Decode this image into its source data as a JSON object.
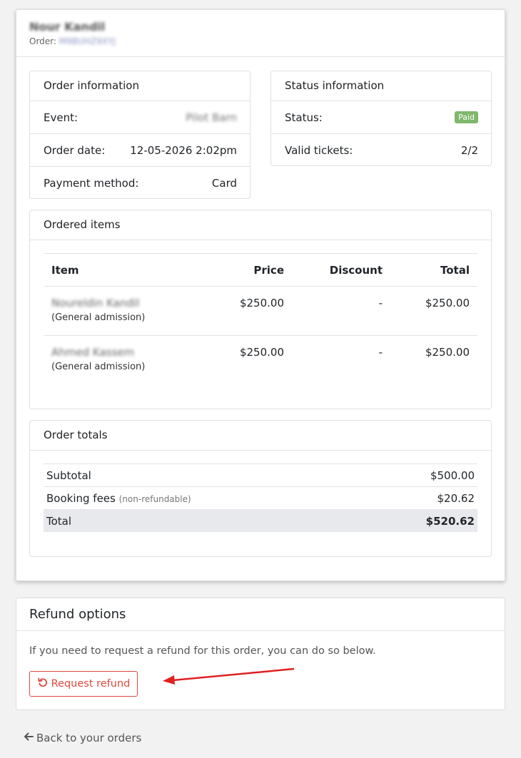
{
  "order": {
    "customer_name": "Nour Kandil",
    "order_label": "Order:",
    "order_number": "M9BUHZ9XYJ"
  },
  "order_information": {
    "title": "Order information",
    "rows": [
      {
        "label": "Event:",
        "value": "Pilot Barn"
      },
      {
        "label": "Order date:",
        "value": "12-05-2026 2:02pm"
      },
      {
        "label": "Payment method:",
        "value": "Card"
      }
    ]
  },
  "status_information": {
    "title": "Status information",
    "rows": [
      {
        "label": "Status:",
        "value": "Paid"
      },
      {
        "label": "Valid tickets:",
        "value": "2/2"
      }
    ]
  },
  "ordered_items": {
    "title": "Ordered items",
    "columns": [
      "Item",
      "Price",
      "Discount",
      "Total"
    ],
    "rows": [
      {
        "name": "Noureldin Kandil",
        "type": "(General admission)",
        "price": "$250.00",
        "discount": "-",
        "total": "$250.00"
      },
      {
        "name": "Ahmed Kassem",
        "type": "(General admission)",
        "price": "$250.00",
        "discount": "-",
        "total": "$250.00"
      }
    ]
  },
  "order_totals": {
    "title": "Order totals",
    "subtotal_label": "Subtotal",
    "subtotal_value": "$500.00",
    "fees_label": "Booking fees",
    "fees_note": "(non-refundable)",
    "fees_value": "$20.62",
    "total_label": "Total",
    "total_value": "$520.62"
  },
  "refund": {
    "title": "Refund options",
    "description": "If you need to request a refund for this order, you can do so below.",
    "button_label": "Request refund"
  },
  "back_link": "Back to your orders",
  "colors": {
    "paid_badge": "#7fb86b",
    "refund_accent": "#e0483e",
    "annotation_arrow": "#e02020",
    "total_row_bg": "#e7e9ec"
  },
  "icons": {
    "refund_icon": "undo-icon",
    "back_icon": "arrow-left-icon"
  }
}
